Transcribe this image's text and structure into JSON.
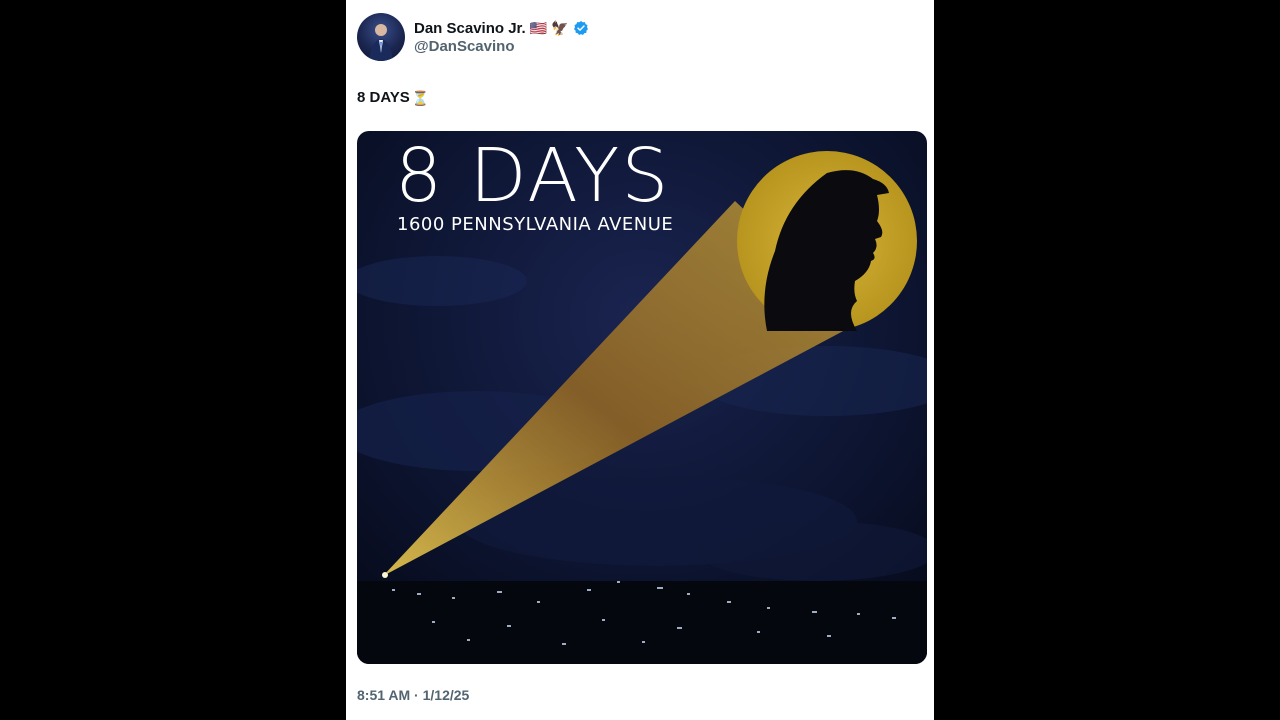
{
  "author": {
    "display_name": "Dan Scavino Jr.",
    "flag_emoji": "🇺🇸",
    "eagle_emoji": "🦅",
    "handle": "@DanScavino"
  },
  "tweet": {
    "text": "8 DAYS",
    "hourglass_emoji": "⏳",
    "timestamp": "8:51 AM · 1/12/25"
  },
  "media": {
    "title": "8 DAYS",
    "subtitle": "1600 PENNSYLVANIA AVENUE"
  },
  "colors": {
    "verified_blue": "#1d9bf0",
    "spotlight_gold": "#c9a227",
    "night_sky": "#0b1230"
  }
}
